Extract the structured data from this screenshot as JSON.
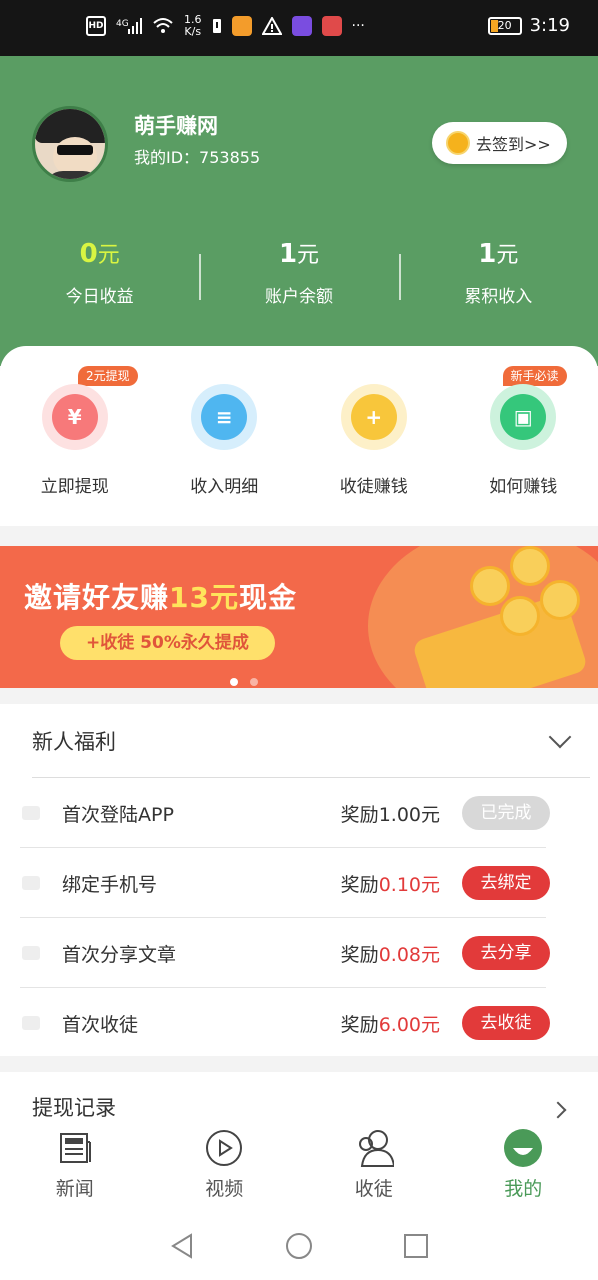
{
  "status_bar": {
    "network": "4G",
    "speed_value": "1.6",
    "speed_unit": "K/s",
    "battery": "20",
    "time": "3:19",
    "more": "···"
  },
  "profile": {
    "name": "萌手赚网",
    "id_text": "我的ID：753855",
    "signin_label": "去签到>>"
  },
  "stats": [
    {
      "value": "0",
      "unit": "元",
      "label": "今日收益",
      "accent": "#d9f542"
    },
    {
      "value": "1",
      "unit": "元",
      "label": "账户余额"
    },
    {
      "value": "1",
      "unit": "元",
      "label": "累积收入"
    }
  ],
  "shortcuts": [
    {
      "label": "立即提现",
      "badge": "2元提现",
      "icon": "yen-icon",
      "color": "#f7797a"
    },
    {
      "label": "收入明细",
      "badge": "",
      "icon": "document-icon",
      "color": "#4fb6f0"
    },
    {
      "label": "收徒赚钱",
      "badge": "",
      "icon": "add-user-icon",
      "color": "#f8c63b"
    },
    {
      "label": "如何赚钱",
      "badge": "新手必读",
      "icon": "wallet-icon",
      "color": "#35c77b"
    }
  ],
  "banner": {
    "title_pre": "邀请好友赚",
    "title_hl": "13元",
    "title_post": "现金",
    "pill": "+收徒 50%永久提成"
  },
  "welfare": {
    "title": "新人福利",
    "tasks": [
      {
        "name": "首次登陆APP",
        "reward_prefix": "奖励",
        "reward_amount": "1.00元",
        "button": "已完成",
        "done": true
      },
      {
        "name": "绑定手机号",
        "reward_prefix": "奖励",
        "reward_amount": "0.10元",
        "button": "去绑定",
        "done": false
      },
      {
        "name": "首次分享文章",
        "reward_prefix": "奖励",
        "reward_amount": "0.08元",
        "button": "去分享",
        "done": false
      },
      {
        "name": "首次收徒",
        "reward_prefix": "奖励",
        "reward_amount": "6.00元",
        "button": "去收徒",
        "done": false
      }
    ]
  },
  "record": {
    "title": "提现记录"
  },
  "tabs": [
    {
      "label": "新闻",
      "icon": "newspaper-icon"
    },
    {
      "label": "视频",
      "icon": "play-circle-icon"
    },
    {
      "label": "收徒",
      "icon": "users-icon"
    },
    {
      "label": "我的",
      "icon": "smile-icon",
      "active": true
    }
  ],
  "colors": {
    "header_green": "#5a9d63",
    "accent_red": "#e23a3a",
    "active_tab": "#4a9a58"
  }
}
